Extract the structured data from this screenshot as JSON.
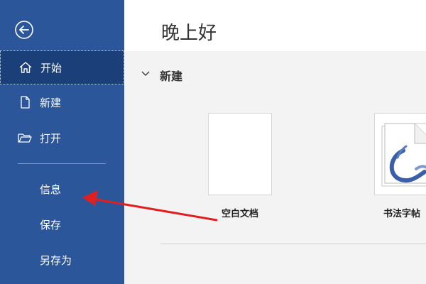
{
  "sidebar": {
    "back_icon": "back-arrow-circle-icon",
    "items_top": [
      {
        "label": "开始",
        "icon": "home-icon",
        "active": true
      },
      {
        "label": "新建",
        "icon": "new-document-icon"
      },
      {
        "label": "打开",
        "icon": "open-folder-icon"
      }
    ],
    "items_bottom": [
      {
        "label": "信息"
      },
      {
        "label": "保存"
      },
      {
        "label": "另存为"
      }
    ],
    "colors": {
      "background": "#2b579a",
      "active": "#1b3f78",
      "text": "#ffffff"
    }
  },
  "main": {
    "greeting": "晚上好",
    "section": {
      "title": "新建",
      "templates": [
        {
          "label": "空白文档"
        },
        {
          "label": "书法字帖"
        }
      ]
    }
  },
  "annotation": {
    "type": "red-arrow",
    "points_to": "信息",
    "color": "#e02020"
  }
}
